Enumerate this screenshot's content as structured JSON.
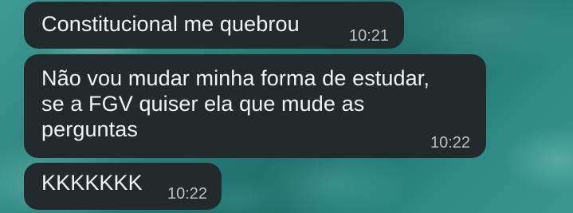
{
  "messages": [
    {
      "text": "Constitucional me quebrou",
      "time": "10:21"
    },
    {
      "text": "Não vou mudar minha forma de estudar,\nse a FGV quiser ela que mude as\nperguntas",
      "time": "10:22"
    },
    {
      "text": "KKKKKKK",
      "time": "10:22"
    }
  ],
  "colors": {
    "bubble": "#232a2c",
    "text": "#f2f4f4",
    "timestamp": "#b8c0c2",
    "wallpaper": "#2a7f79"
  }
}
